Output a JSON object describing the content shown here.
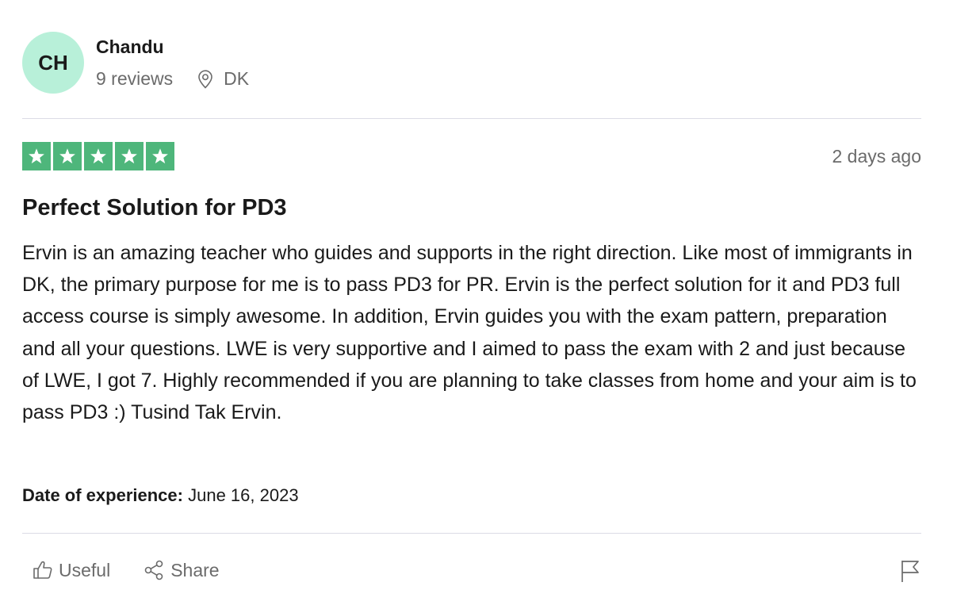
{
  "reviewer": {
    "initials": "CH",
    "name": "Chandu",
    "reviews_count": "9 reviews",
    "location": "DK",
    "avatar_color": "#b8f0d9"
  },
  "review": {
    "rating": 5,
    "max_rating": 5,
    "star_color": "#4eb67b",
    "date": "2 days ago",
    "title": "Perfect Solution for PD3",
    "body": "Ervin is an amazing teacher who guides and supports in the right direction. Like most of immigrants in DK, the primary purpose for me is to pass PD3 for PR. Ervin is the perfect solution for it and PD3 full access course is simply awesome. In addition, Ervin guides you with the exam pattern, preparation and all your questions. LWE is very supportive and I aimed to pass the exam with 2 and just because of LWE, I got 7. Highly recommended if you are planning to take classes from home and your aim is to pass PD3 :) Tusind Tak Ervin.",
    "experience_label": "Date of experience:",
    "experience_date": "June 16, 2023"
  },
  "actions": {
    "useful_label": "Useful",
    "share_label": "Share",
    "icons": {
      "useful": "thumbs-up-icon",
      "share": "share-icon",
      "report": "flag-icon",
      "location": "location-pin-icon"
    }
  }
}
